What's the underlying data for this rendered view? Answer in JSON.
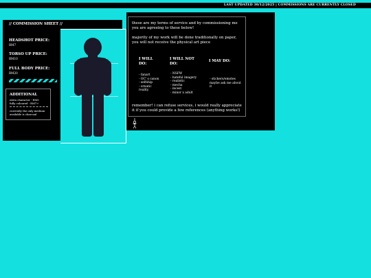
{
  "header": {
    "status_text": "LAST UPDATED 30/12/2025 | COMMISSIONS ARE CURRENTLY CLOSED"
  },
  "commission_sheet": {
    "title": "// COMMISSION SHEET //",
    "prices": [
      {
        "label": "HEADSHOT PRICE:",
        "value": "RM7"
      },
      {
        "label": "TORSO UP PRICE:",
        "value": "RM10"
      },
      {
        "label": "FULL BODY PRICE:",
        "value": "RM20"
      }
    ],
    "additional": {
      "title": "ADDITIONAL",
      "lines": [
        "extra character - RM5",
        "fully coloured - RM7+"
      ],
      "notes": [
        "currently the only medium",
        "available is charcoal"
      ]
    }
  },
  "terms": {
    "intro": "these are my terms of service and by commissioning me you are agreeing to these below!",
    "note": "majority of my work will be done traditionally on paper, you will not receive the physical art piece",
    "will_do": {
      "heading_line1": "I WILL",
      "heading_line2": "DO:",
      "items": [
        "- fanart",
        "- OC' s canon",
        "- selfship",
        "- ornatic",
        "reality"
      ]
    },
    "will_not_do": {
      "heading_line1": "I WILL NOT",
      "heading_line2": "DO:",
      "items": [
        "- NSFW",
        "- hateful imagery",
        "- realistic",
        "- mecha",
        "- incest",
        "- minor x adult"
      ]
    },
    "may_do": {
      "heading": "I MAY DO:",
      "items": [
        "- stickers/emotes",
        "maybe ask me about",
        "it"
      ]
    },
    "footer": "remember! i can refuse services, i would really appreciate it if you could provide a few references (anything works!)"
  },
  "colors": {
    "background": "#14e0e0",
    "panel": "#000000",
    "silhouette": "#1a1a2a"
  }
}
